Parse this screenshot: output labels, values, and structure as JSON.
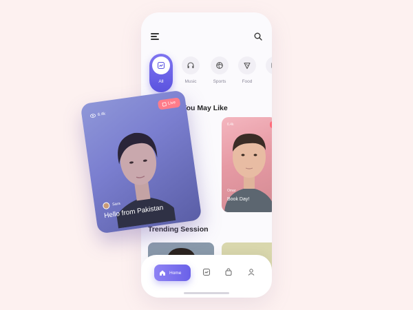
{
  "categories": [
    {
      "label": "All",
      "icon": "trending-icon",
      "active": true
    },
    {
      "label": "Music",
      "icon": "headphones-icon"
    },
    {
      "label": "Sports",
      "icon": "ball-icon"
    },
    {
      "label": "Food",
      "icon": "pizza-icon"
    },
    {
      "label": "Ne",
      "icon": "news-icon"
    }
  ],
  "sections": {
    "sessions_title": "ons You May Like",
    "trending_title": "Trending Session"
  },
  "small_card": {
    "views": "6.4k",
    "user": "Omar",
    "caption": "Book Day!"
  },
  "featured_card": {
    "views": "6.4k",
    "live_label": "Live",
    "user": "Sara",
    "title": "Hello from Pakistan"
  },
  "bottom_nav": {
    "home_label": "Home"
  },
  "colors": {
    "accent": "#6a61e8",
    "live": "#ff7c8a",
    "background": "#fdf1f0"
  }
}
